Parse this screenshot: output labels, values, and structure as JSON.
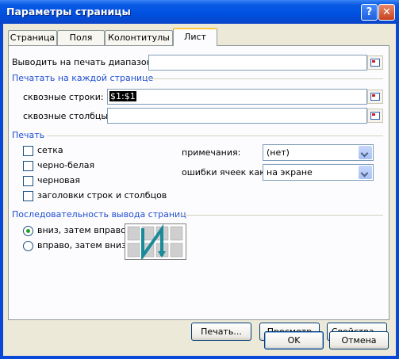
{
  "window": {
    "title": "Параметры страницы",
    "help_label": "?",
    "close_label": "✕"
  },
  "tabs": [
    {
      "label": "Страница"
    },
    {
      "label": "Поля"
    },
    {
      "label": "Колонтитулы"
    },
    {
      "label": "Лист",
      "active": true
    }
  ],
  "sheet": {
    "print_area_label": "Выводить на печать диапазон:",
    "print_area_value": "",
    "print_titles_group": "Печатать на каждой странице",
    "rows_label": "сквозные строки:",
    "rows_value": "$1:$1",
    "cols_label": "сквозные столбцы:",
    "cols_value": ""
  },
  "print": {
    "group": "Печать",
    "checkboxes": [
      {
        "label": "сетка",
        "checked": false
      },
      {
        "label": "черно-белая",
        "checked": false
      },
      {
        "label": "черновая",
        "checked": false
      },
      {
        "label": "заголовки строк и столбцов",
        "checked": false
      }
    ],
    "comments_label": "примечания:",
    "comments_value": "(нет)",
    "errors_label": "ошибки ячеек как:",
    "errors_value": "на экране"
  },
  "order": {
    "group": "Последовательность вывода страниц",
    "down_then_over": "вниз, затем вправо",
    "over_then_down": "вправо, затем вниз",
    "selected": "down_then_over"
  },
  "buttons": {
    "print": "Печать...",
    "preview": "Просмотр",
    "options": "Свойства...",
    "ok": "OK",
    "cancel": "Отмена"
  },
  "colors": {
    "titlebar": "#0050e0",
    "group_text": "#1f4ed0",
    "dialog_bg": "#ece9d8"
  }
}
